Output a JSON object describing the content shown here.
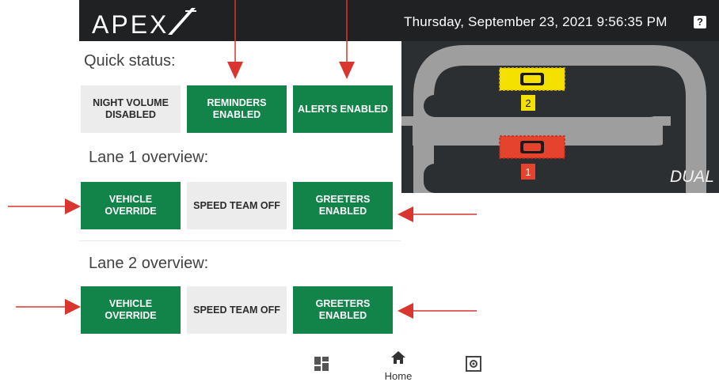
{
  "header": {
    "logo_text": "APEX",
    "datetime": "Thursday, September 23, 2021 9:56:35 PM",
    "help_label": "?"
  },
  "map": {
    "mode_label": "DUAL",
    "lane_markers": [
      "2",
      "1"
    ],
    "colors": {
      "lane2_car": "#f4e100",
      "lane1_car": "#e5432e",
      "track": "#9e9e9e"
    }
  },
  "quick_status": {
    "title": "Quick status:",
    "buttons": [
      "NIGHT VOLUME DISABLED",
      "REMINDERS ENABLED",
      "ALERTS ENABLED"
    ]
  },
  "lane1": {
    "title": "Lane 1 overview:",
    "buttons": [
      "VEHICLE OVERRIDE",
      "SPEED TEAM OFF",
      "GREETERS ENABLED"
    ]
  },
  "lane2": {
    "title": "Lane 2 overview:",
    "buttons": [
      "VEHICLE OVERRIDE",
      "SPEED TEAM OFF",
      "GREETERS ENABLED"
    ]
  },
  "bottom_nav": {
    "items": [
      {
        "icon": "dashboard-icon",
        "label": ""
      },
      {
        "icon": "home-icon",
        "label": "Home"
      },
      {
        "icon": "settings-icon",
        "label": ""
      }
    ]
  },
  "colors": {
    "button_green": "#12844a",
    "button_gray": "#ececec",
    "topbar": "#1f2123",
    "annotation_arrow": "#d9362f"
  }
}
